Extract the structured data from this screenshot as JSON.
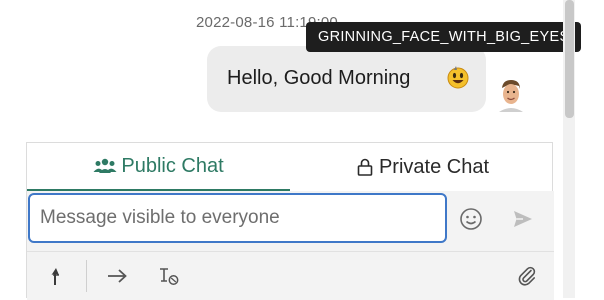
{
  "message": {
    "timestamp": "2022-08-16 11:19:00",
    "text": "Hello, Good Morning",
    "emoji_icon": "grinning-face-with-big-eyes-icon",
    "avatar_icon": "user-avatar"
  },
  "tooltip": {
    "text": "GRINNING_FACE_WITH_BIG_EYES"
  },
  "tabs": {
    "public_label": "Public Chat",
    "private_label": "Private Chat",
    "active": "public"
  },
  "composer": {
    "placeholder": "Message visible to everyone",
    "value": ""
  },
  "icons": {
    "emoji_picker": "smiley-icon",
    "send": "send-icon",
    "mention": "mention-icon",
    "arrow": "arrow-right-icon",
    "format": "format-icon",
    "attach": "paperclip-icon"
  },
  "colors": {
    "accent_green": "#2e7a64",
    "input_border_blue": "#3f78c8",
    "tooltip_bg": "#1e1e1e",
    "bubble_bg": "#ececec"
  }
}
